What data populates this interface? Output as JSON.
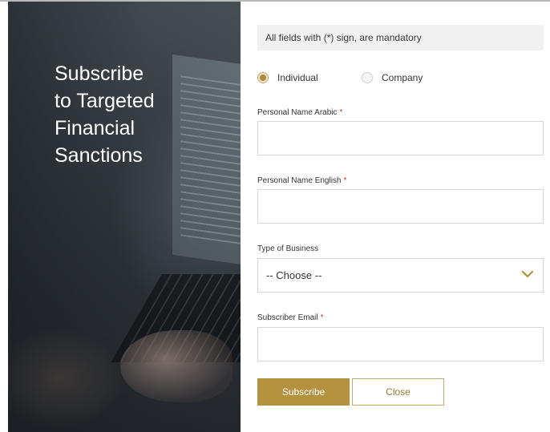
{
  "hero": {
    "title_lines": [
      "Subscribe",
      "to Targeted",
      "Financial",
      "Sanctions"
    ]
  },
  "form": {
    "notice": "All fields with (*) sign, are mandatory",
    "subscriber_type": {
      "options": [
        "Individual",
        "Company"
      ],
      "selected": "Individual"
    },
    "fields": {
      "name_arabic": {
        "label": "Personal Name Arabic",
        "required_mark": "*",
        "value": ""
      },
      "name_english": {
        "label": "Personal Name English",
        "required_mark": "*",
        "value": ""
      },
      "business_type": {
        "label": "Type of Business",
        "selected": "-- Choose --"
      },
      "email": {
        "label": "Subscriber Email",
        "required_mark": "*",
        "value": ""
      }
    },
    "buttons": {
      "subscribe": "Subscribe",
      "close": "Close"
    }
  },
  "colors": {
    "accent": "#b4913f",
    "required": "#c0392b"
  }
}
